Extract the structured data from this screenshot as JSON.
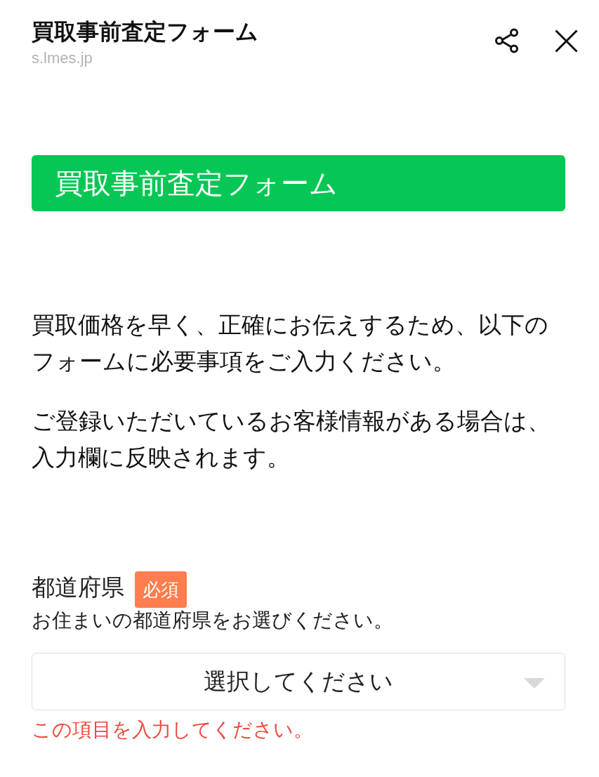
{
  "header": {
    "title": "買取事前査定フォーム",
    "url": "s.lmes.jp"
  },
  "banner": {
    "title": "買取事前査定フォーム"
  },
  "intro": [
    "買取価格を早く、正確にお伝えするため、以下のフォームに必要事項をご入力ください。",
    "ご登録いただいているお客様情報がある場合は、入力欄に反映されます。"
  ],
  "fields": [
    {
      "kind": "select",
      "label": "都道府県",
      "required": true,
      "required_badge": "必須",
      "hint": "お住まいの都道府県をお選びください。",
      "placeholder": "選択してください",
      "error": "この項目を入力してください。"
    }
  ]
}
